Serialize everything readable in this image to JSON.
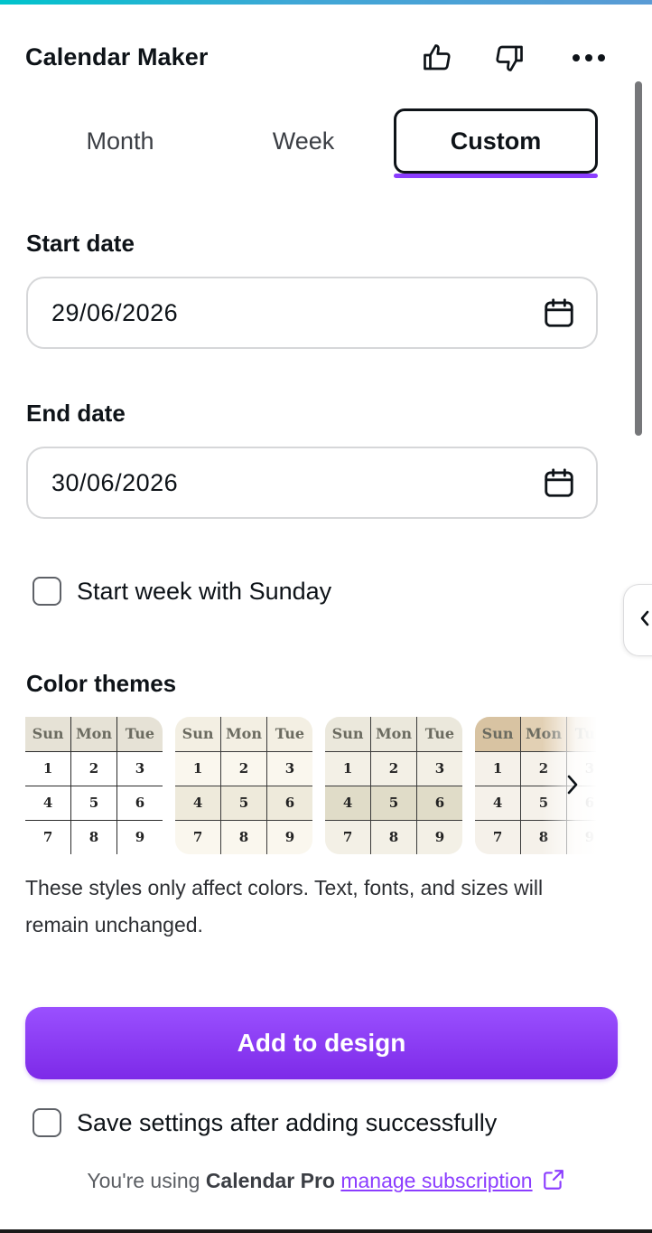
{
  "header": {
    "title": "Calendar Maker",
    "icons": [
      "thumbs-up-icon",
      "thumbs-down-icon",
      "more-options-icon"
    ]
  },
  "tabs": [
    {
      "label": "Month",
      "active": false
    },
    {
      "label": "Week",
      "active": false
    },
    {
      "label": "Custom",
      "active": true
    }
  ],
  "start_date": {
    "label": "Start date",
    "value": "29/06/2026"
  },
  "end_date": {
    "label": "End date",
    "value": "30/06/2026"
  },
  "week_option": {
    "label": "Start week with Sunday",
    "checked": false
  },
  "color_themes": {
    "label": "Color themes",
    "header_days": [
      "Sun",
      "Mon",
      "Tue"
    ],
    "rows": [
      [
        "1",
        "2",
        "3"
      ],
      [
        "4",
        "5",
        "6"
      ],
      [
        "7",
        "8",
        "9"
      ]
    ],
    "themes": [
      {
        "name": "theme-1",
        "header_bg": "#e6e2d6",
        "body_bg": "#ffffff",
        "accent_row_bg": "#ffffff",
        "border": "#2b2b2b"
      },
      {
        "name": "theme-2",
        "header_bg": "#f3efe3",
        "body_bg": "#faf7ee",
        "accent_row_bg": "#eeeadb",
        "border": "#3a3a3a"
      },
      {
        "name": "theme-3",
        "header_bg": "#ebe8dc",
        "body_bg": "#f3f0e6",
        "accent_row_bg": "#e0dcc8",
        "border": "#3a3a3a"
      },
      {
        "name": "theme-4",
        "header_bg": "#dcc8aa",
        "body_bg": "#f5f1ea",
        "accent_row_bg": "#f5f1ea",
        "border": "#3a3a3a"
      }
    ],
    "note": "These styles only affect colors. Text, fonts, and sizes will remain unchanged."
  },
  "add_button": {
    "label": "Add to design"
  },
  "save_option": {
    "label": "Save settings after adding successfully",
    "checked": false
  },
  "footer": {
    "prefix": "You're using ",
    "plan": "Calendar Pro",
    "link": "manage subscription"
  },
  "colors": {
    "accent": "#8b3dff",
    "button_gradient_top": "#9a50ff",
    "button_gradient_bottom": "#7d2ae8"
  }
}
